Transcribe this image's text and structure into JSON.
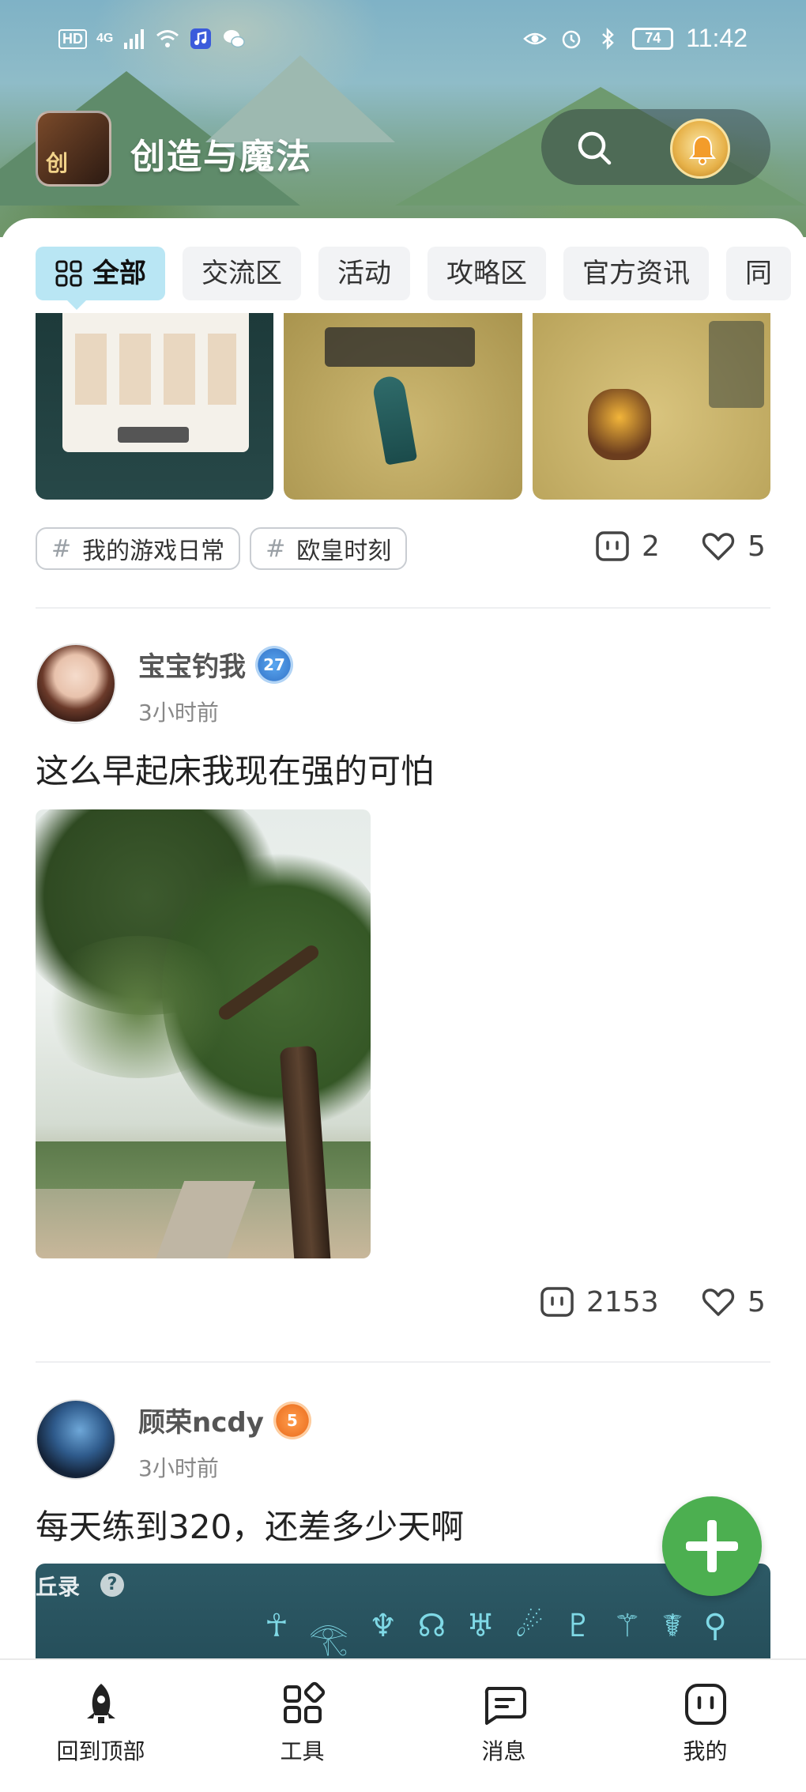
{
  "status_bar": {
    "network": "HD",
    "signal": "4G",
    "battery": "74",
    "time": "11:42"
  },
  "header": {
    "app_name": "创造与魔法",
    "logo_text": "创",
    "search_icon": "search-icon",
    "notify_icon": "bell-icon"
  },
  "tabs": [
    {
      "label": "全部",
      "active": true
    },
    {
      "label": "交流区",
      "active": false
    },
    {
      "label": "活动",
      "active": false
    },
    {
      "label": "攻略区",
      "active": false
    },
    {
      "label": "官方资讯",
      "active": false
    },
    {
      "label": "同",
      "active": false
    }
  ],
  "post1": {
    "tags": [
      "我的游戏日常",
      "欧皇时刻"
    ],
    "comments": "2",
    "likes": "5"
  },
  "post2": {
    "username": "宝宝钓我",
    "level": "27",
    "time": "3小时前",
    "text": "这么早起床我现在强的可怕",
    "comments": "2153",
    "likes": "5"
  },
  "post3": {
    "username": "顾荣ncdy",
    "level": "5",
    "time": "3小时前",
    "text": "每天练到320，还差多少天啊",
    "image_title": "丘录"
  },
  "bottom_nav": [
    {
      "label": "回到顶部",
      "icon": "rocket-icon"
    },
    {
      "label": "工具",
      "icon": "grid-icon"
    },
    {
      "label": "消息",
      "icon": "message-icon"
    },
    {
      "label": "我的",
      "icon": "face-icon"
    }
  ],
  "colors": {
    "active_tab": "#b9e6f4",
    "fab": "#4caf50",
    "level_blue": "#3f83d4",
    "level_orange": "#f07a2a"
  }
}
